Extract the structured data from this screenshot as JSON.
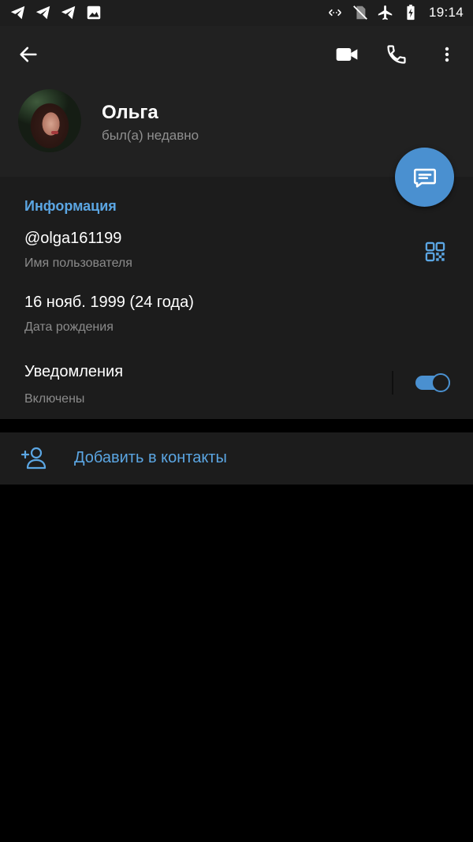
{
  "status_bar": {
    "time": "19:14",
    "left_icons": [
      "telegram-icon",
      "telegram-icon",
      "telegram-icon",
      "image-icon"
    ],
    "right_icons": [
      "data-saver-icon",
      "no-sim-icon",
      "airplane-icon",
      "battery-charging-icon"
    ]
  },
  "header": {
    "back_icon": "arrow-left-icon",
    "actions": [
      "video-call-icon",
      "phone-icon",
      "more-vert-icon"
    ],
    "profile": {
      "name": "Ольга",
      "status": "был(а) недавно"
    },
    "fab_icon": "message-icon"
  },
  "info": {
    "title": "Информация",
    "username": {
      "value": "@olga161199",
      "label": "Имя пользователя"
    },
    "birthday": {
      "value": "16 нояб. 1999 (24 года)",
      "label": "Дата рождения"
    },
    "notifications": {
      "value": "Уведомления",
      "label": "Включены",
      "enabled": true
    }
  },
  "add_contact": {
    "label": "Добавить в контакты",
    "icon": "add-person-icon"
  },
  "colors": {
    "accent": "#4a90d0",
    "accent_text": "#5ba6e3",
    "header_bg": "#212121",
    "section_bg": "#1c1c1c",
    "page_bg": "#000000"
  }
}
